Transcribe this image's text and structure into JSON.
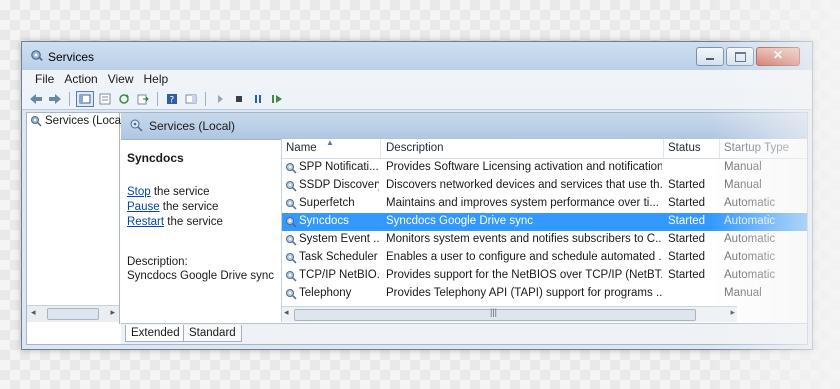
{
  "window": {
    "title": "Services"
  },
  "menu": [
    {
      "label": "File"
    },
    {
      "label": "Action"
    },
    {
      "label": "View"
    },
    {
      "label": "Help"
    }
  ],
  "tree": {
    "root_label": "Services (Local)"
  },
  "right_header": {
    "label": "Services (Local)"
  },
  "detail": {
    "service_name": "Syncdocs",
    "stop_link": "Stop",
    "stop_rest": " the service",
    "pause_link": "Pause",
    "pause_rest": " the service",
    "restart_link": "Restart",
    "restart_rest": " the service",
    "description_label": "Description:",
    "description_text": "Syncdocs Google Drive sync"
  },
  "table": {
    "columns": [
      "Name",
      "Description",
      "Status",
      "Startup Type"
    ],
    "rows": [
      {
        "name": "SPP Notificati...",
        "description": "Provides Software Licensing activation and notification",
        "status": "",
        "startup": "Manual"
      },
      {
        "name": "SSDP Discovery",
        "description": "Discovers networked devices and services that use th...",
        "status": "Started",
        "startup": "Manual"
      },
      {
        "name": "Superfetch",
        "description": "Maintains and improves system performance over ti...",
        "status": "Started",
        "startup": "Automatic"
      },
      {
        "name": "Syncdocs",
        "description": "Syncdocs Google Drive sync",
        "status": "Started",
        "startup": "Automatic"
      },
      {
        "name": "System Event ...",
        "description": "Monitors system events and notifies subscribers to C...",
        "status": "Started",
        "startup": "Automatic"
      },
      {
        "name": "Task Scheduler",
        "description": "Enables a user to configure and schedule automated ...",
        "status": "Started",
        "startup": "Automatic"
      },
      {
        "name": "TCP/IP NetBIO...",
        "description": "Provides support for the NetBIOS over TCP/IP (NetBT...",
        "status": "Started",
        "startup": "Automatic"
      },
      {
        "name": "Telephony",
        "description": "Provides Telephony API (TAPI) support for programs ...",
        "status": "",
        "startup": "Manual"
      }
    ],
    "selected_index": 3
  },
  "tabs": [
    {
      "label": "Extended"
    },
    {
      "label": "Standard"
    }
  ],
  "colors": {
    "selection": "#3399ff",
    "link": "#0645ad"
  }
}
